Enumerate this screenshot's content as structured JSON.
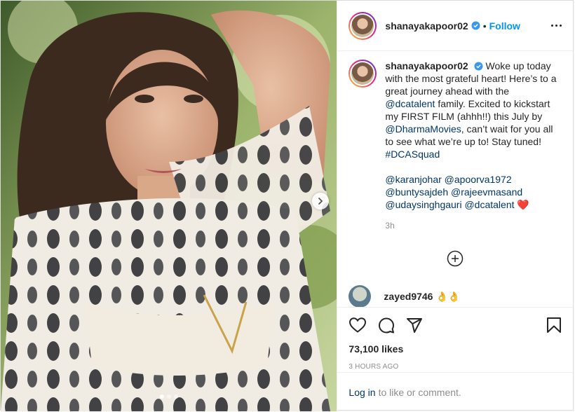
{
  "post": {
    "username": "shanayakapoor02",
    "follow_label": "Follow",
    "bullet": "•",
    "caption": {
      "username": "shanayakapoor02",
      "part1": "Woke up today with the most grateful heart! Here’s to a great journey ahead with the",
      "mention1": "@dcatalent",
      "part2": "family. Excited to kickstart my FIRST FILM (ahhh!!) this July by",
      "mention2": "@DharmaMovies",
      "part3": ", can’t wait for you all to see what we’re up to! Stay tuned!",
      "hashtag": "#DCASquad",
      "tags": [
        "@karanjohar",
        "@apoorva1972",
        "@buntysajdeh",
        "@rajeevmasand",
        "@udaysinghgauri",
        "@dcatalent"
      ],
      "emoji": "❤️"
    },
    "time": "3h",
    "comment": {
      "username": "zayed9746",
      "text": "👌👌"
    },
    "likes": "73,100 likes",
    "posted_ago": "3 HOURS AGO",
    "login_link": "Log in",
    "login_text": "to like or comment."
  },
  "carousel": {
    "slides": 3,
    "active": 1
  },
  "colors": {
    "accent": "#0095f6",
    "link": "#00376b",
    "muted": "#8e8e8e",
    "heart": "#ed4956"
  },
  "icons": [
    "verified-badge-icon",
    "more-options-icon",
    "chevron-right-icon",
    "add-circle-icon",
    "heart-icon",
    "comment-icon",
    "share-icon",
    "bookmark-icon"
  ]
}
